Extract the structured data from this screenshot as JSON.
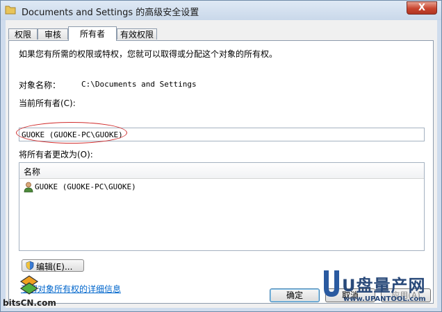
{
  "window": {
    "title": "Documents and Settings 的高级安全设置",
    "close_glyph": "X"
  },
  "tabs": [
    {
      "label": "权限",
      "active": false
    },
    {
      "label": "审核",
      "active": false
    },
    {
      "label": "所有者",
      "active": true
    },
    {
      "label": "有效权限",
      "active": false
    }
  ],
  "owner_tab": {
    "description": "如果您有所需的权限或特权，您就可以取得或分配这个对象的所有权。",
    "object_name_label": "对象名称：",
    "object_name_value": "C:\\Documents and Settings",
    "current_owner_label": "当前所有者(C):",
    "current_owner_value": "GUOKE (GUOKE-PC\\GUOKE)",
    "change_owner_label": "将所有者更改为(O):",
    "list_header": "名称",
    "list_rows": [
      {
        "name": "GUOKE (GUOKE-PC\\GUOKE)",
        "icon": "user-icon"
      }
    ],
    "edit_button": "编辑(E)...",
    "learn_more_link": "了解对象所有权的详细信息"
  },
  "buttons": {
    "ok": "确定",
    "cancel": "取消",
    "apply": "应用(A)"
  },
  "watermarks": {
    "left": "bitsCN.com",
    "right_title": "U盘量产网",
    "right_url": "www.UPANTOOL.com"
  },
  "colors": {
    "link": "#0066cc",
    "highlight_ellipse": "#d02a2a",
    "watermark_blue": "#2a4a7a"
  }
}
